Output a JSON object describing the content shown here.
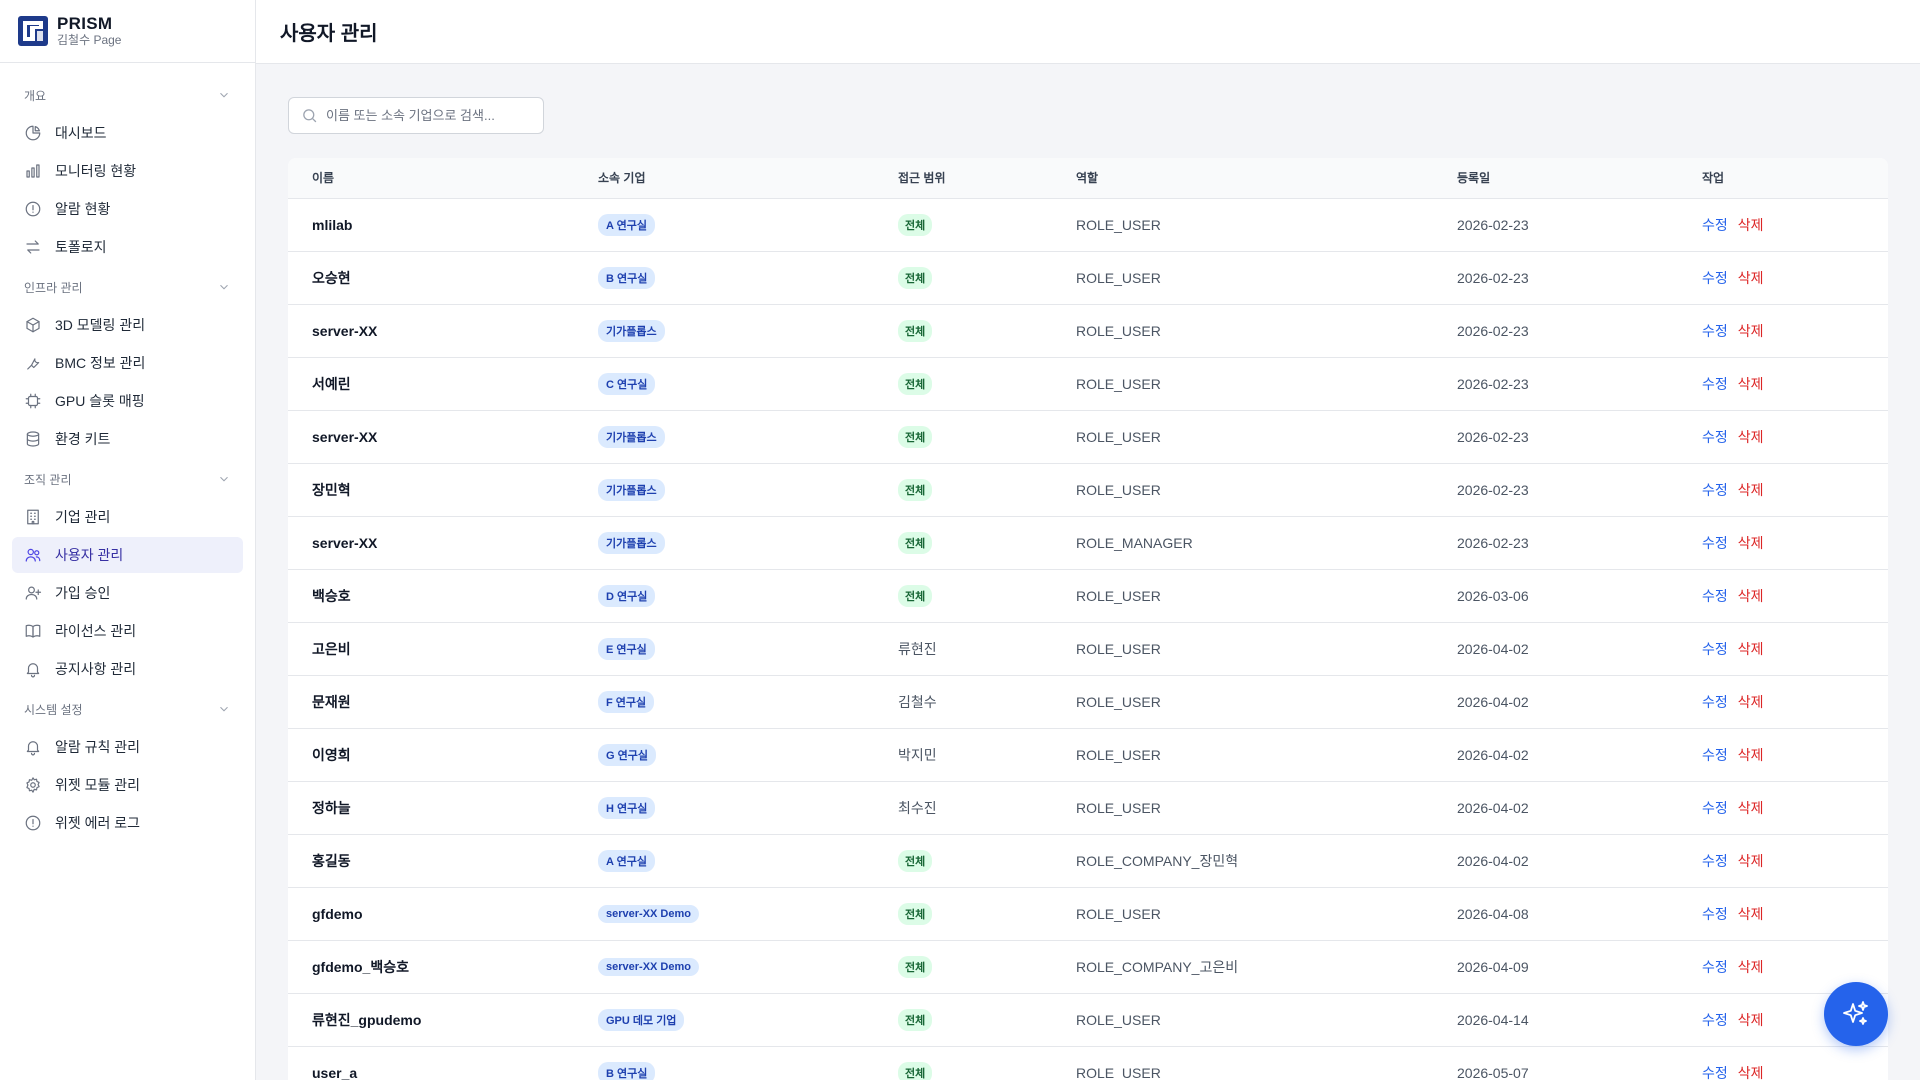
{
  "brand": {
    "title": "PRISM",
    "subtitle": "김철수 Page"
  },
  "page": {
    "title": "사용자 관리"
  },
  "search": {
    "placeholder": "이름 또는 소속 기업으로 검색...",
    "value": ""
  },
  "sidebar": {
    "sections": [
      {
        "label": "개요",
        "items": [
          {
            "label": "대시보드",
            "icon": "chart-pie-icon"
          },
          {
            "label": "모니터링 현황",
            "icon": "bar-chart-icon"
          },
          {
            "label": "알람 현황",
            "icon": "alert-circle-icon"
          },
          {
            "label": "토폴로지",
            "icon": "arrows-swap-icon"
          }
        ]
      },
      {
        "label": "인프라 관리",
        "items": [
          {
            "label": "3D 모델링 관리",
            "icon": "cube-icon"
          },
          {
            "label": "BMC 정보 관리",
            "icon": "wrench-icon"
          },
          {
            "label": "GPU 슬롯 매핑",
            "icon": "chip-icon"
          },
          {
            "label": "환경 키트",
            "icon": "database-icon"
          }
        ]
      },
      {
        "label": "조직 관리",
        "items": [
          {
            "label": "기업 관리",
            "icon": "building-icon"
          },
          {
            "label": "사용자 관리",
            "icon": "users-icon",
            "active": true
          },
          {
            "label": "가입 승인",
            "icon": "user-plus-icon"
          },
          {
            "label": "라이선스 관리",
            "icon": "book-icon"
          },
          {
            "label": "공지사항 관리",
            "icon": "bell-icon"
          }
        ]
      },
      {
        "label": "시스템 설정",
        "items": [
          {
            "label": "알람 규칙 관리",
            "icon": "bell-icon"
          },
          {
            "label": "위젯 모듈 관리",
            "icon": "gear-icon"
          },
          {
            "label": "위젯 에러 로그",
            "icon": "alert-circle-icon"
          }
        ]
      }
    ]
  },
  "table": {
    "columns": [
      "이름",
      "소속 기업",
      "접근 범위",
      "역할",
      "등록일",
      "작업"
    ],
    "edit_label": "수정",
    "delete_label": "삭제",
    "rows": [
      {
        "name": "mlilab",
        "company": "A 연구실",
        "scope": "전체",
        "role": "ROLE_USER",
        "date": "2026-02-23"
      },
      {
        "name": "오승현",
        "company": "B 연구실",
        "scope": "전체",
        "role": "ROLE_USER",
        "date": "2026-02-23"
      },
      {
        "name": "server-XX",
        "company": "기가플롭스",
        "scope": "전체",
        "role": "ROLE_USER",
        "date": "2026-02-23"
      },
      {
        "name": "서예린",
        "company": "C 연구실",
        "scope": "전체",
        "role": "ROLE_USER",
        "date": "2026-02-23"
      },
      {
        "name": "server-XX",
        "company": "기가플롭스",
        "scope": "전체",
        "role": "ROLE_USER",
        "date": "2026-02-23"
      },
      {
        "name": "장민혁",
        "company": "기가플롭스",
        "scope": "전체",
        "role": "ROLE_USER",
        "date": "2026-02-23"
      },
      {
        "name": "server-XX",
        "company": "기가플롭스",
        "scope": "전체",
        "role": "ROLE_MANAGER",
        "date": "2026-02-23"
      },
      {
        "name": "백승호",
        "company": "D 연구실",
        "scope": "전체",
        "role": "ROLE_USER",
        "date": "2026-03-06"
      },
      {
        "name": "고은비",
        "company": "E 연구실",
        "scope": "류현진",
        "role": "ROLE_USER",
        "date": "2026-04-02"
      },
      {
        "name": "문재원",
        "company": "F 연구실",
        "scope": "김철수",
        "role": "ROLE_USER",
        "date": "2026-04-02"
      },
      {
        "name": "이영희",
        "company": "G 연구실",
        "scope": "박지민",
        "role": "ROLE_USER",
        "date": "2026-04-02"
      },
      {
        "name": "정하늘",
        "company": "H 연구실",
        "scope": "최수진",
        "role": "ROLE_USER",
        "date": "2026-04-02"
      },
      {
        "name": "홍길동",
        "company": "A 연구실",
        "scope": "전체",
        "role": "ROLE_COMPANY_장민혁",
        "date": "2026-04-02"
      },
      {
        "name": "gfdemo",
        "company": "server-XX Demo",
        "scope": "전체",
        "role": "ROLE_USER",
        "date": "2026-04-08"
      },
      {
        "name": "gfdemo_백승호",
        "company": "server-XX Demo",
        "scope": "전체",
        "role": "ROLE_COMPANY_고은비",
        "date": "2026-04-09"
      },
      {
        "name": "류현진_gpudemo",
        "company": "GPU 데모 기업",
        "scope": "전체",
        "role": "ROLE_USER",
        "date": "2026-04-14"
      },
      {
        "name": "user_a",
        "company": "B 연구실",
        "scope": "전체",
        "role": "ROLE_USER",
        "date": "2026-05-07"
      }
    ]
  },
  "fab": {
    "icon": "sparkles-icon"
  },
  "colors": {
    "accent": "#2563eb",
    "danger": "#dc2626",
    "active_bg": "#eef0fb",
    "badge_company_bg": "#dbeafe",
    "badge_scope_bg": "#dcfce7"
  }
}
